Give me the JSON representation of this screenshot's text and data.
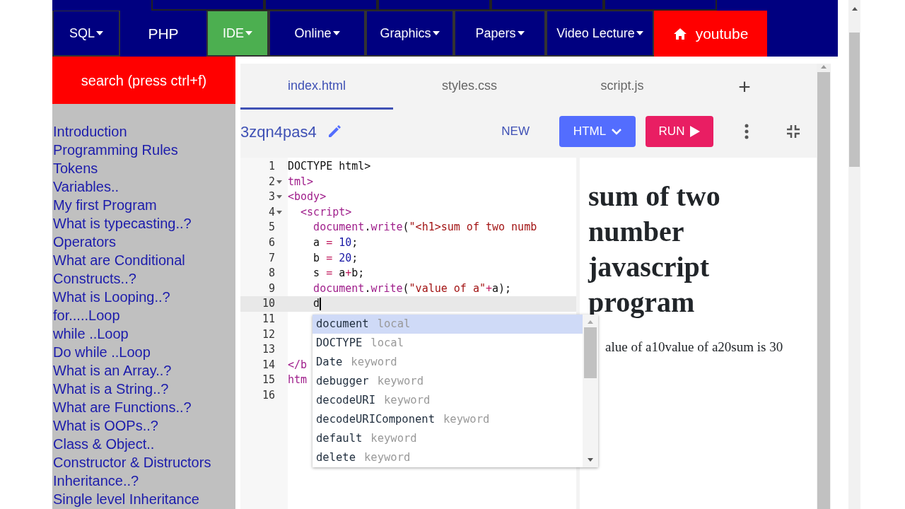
{
  "top_nav": {
    "items": [
      {
        "label": "SQL",
        "kind": "dropdown",
        "color": "#000080"
      },
      {
        "label": "PHP",
        "kind": "plain",
        "color": "#000080"
      },
      {
        "label": "IDE",
        "kind": "dropdown",
        "color": "#4caf50"
      },
      {
        "label": "Online",
        "kind": "dropdown",
        "color": "#000080"
      },
      {
        "label": "Graphics",
        "kind": "dropdown",
        "color": "#000080"
      },
      {
        "label": "Papers",
        "kind": "dropdown",
        "color": "#000080"
      },
      {
        "label": "Video Lecture",
        "kind": "dropdown",
        "color": "#000080"
      },
      {
        "label": "youtube",
        "kind": "home",
        "color": "#ff0000"
      }
    ]
  },
  "sidebar": {
    "search_button": "search (press ctrl+f)",
    "links": [
      "Introduction",
      "Programming Rules",
      "Tokens",
      "Variables..",
      "My first Program",
      "What is typecasting..?",
      "Operators",
      "What are Conditional Constructs..?",
      "What is Looping..?",
      "for.....Loop",
      "while ..Loop",
      "Do while ..Loop",
      "What is an Array..?",
      "What is a String..?",
      "What are Functions..?",
      "What is OOPs..?",
      "Class & Object..",
      "Constructor & Distructors",
      "Inheritance..?",
      "Single level Inheritance"
    ]
  },
  "ide": {
    "tabs": [
      {
        "label": "index.html",
        "selected": true
      },
      {
        "label": "styles.css",
        "selected": false
      },
      {
        "label": "script.js",
        "selected": false
      }
    ],
    "add_tab": "+",
    "project_name": "3zqn4pas4",
    "new_button": "NEW",
    "language_button": "HTML",
    "run_button": "RUN",
    "code_lines": [
      {
        "number": "1",
        "fold": false,
        "active": false,
        "segments": [
          {
            "kind": "plain",
            "text": "DOCTYPE html>"
          }
        ]
      },
      {
        "number": "2",
        "fold": true,
        "active": false,
        "segments": [
          {
            "kind": "tag",
            "text": "tml>"
          }
        ]
      },
      {
        "number": "3",
        "fold": true,
        "active": false,
        "segments": [
          {
            "kind": "tag",
            "text": "<body>"
          }
        ]
      },
      {
        "number": "4",
        "fold": true,
        "active": false,
        "segments": [
          {
            "kind": "tag",
            "text": "  <script>"
          }
        ]
      },
      {
        "number": "5",
        "fold": false,
        "active": false,
        "segments": [
          {
            "kind": "variable",
            "text": "    document"
          },
          {
            "kind": "plain",
            "text": "."
          },
          {
            "kind": "variable",
            "text": "write"
          },
          {
            "kind": "plain",
            "text": "("
          },
          {
            "kind": "string",
            "text": "\"<h1>sum of two numb"
          }
        ]
      },
      {
        "number": "6",
        "fold": false,
        "active": false,
        "segments": [
          {
            "kind": "plain",
            "text": "    a "
          },
          {
            "kind": "operator",
            "text": "="
          },
          {
            "kind": "number",
            "text": " 10"
          },
          {
            "kind": "plain",
            "text": ";"
          }
        ]
      },
      {
        "number": "7",
        "fold": false,
        "active": false,
        "segments": [
          {
            "kind": "plain",
            "text": "    b "
          },
          {
            "kind": "operator",
            "text": "="
          },
          {
            "kind": "number",
            "text": " 20"
          },
          {
            "kind": "plain",
            "text": ";"
          }
        ]
      },
      {
        "number": "8",
        "fold": false,
        "active": false,
        "segments": [
          {
            "kind": "plain",
            "text": "    s "
          },
          {
            "kind": "operator",
            "text": "="
          },
          {
            "kind": "plain",
            "text": " a"
          },
          {
            "kind": "operator",
            "text": "+"
          },
          {
            "kind": "plain",
            "text": "b;"
          }
        ]
      },
      {
        "number": "9",
        "fold": false,
        "active": false,
        "segments": [
          {
            "kind": "variable",
            "text": "    document"
          },
          {
            "kind": "plain",
            "text": "."
          },
          {
            "kind": "variable",
            "text": "write"
          },
          {
            "kind": "plain",
            "text": "("
          },
          {
            "kind": "string",
            "text": "\"value of a\""
          },
          {
            "kind": "operator",
            "text": "+"
          },
          {
            "kind": "plain",
            "text": "a);"
          }
        ]
      },
      {
        "number": "10",
        "fold": false,
        "active": true,
        "segments": [
          {
            "kind": "plain",
            "text": "    d"
          }
        ]
      },
      {
        "number": "11",
        "fold": false,
        "active": false
      },
      {
        "number": "12",
        "fold": false,
        "active": false
      },
      {
        "number": "13",
        "fold": false,
        "active": false
      },
      {
        "number": "14",
        "fold": false,
        "active": false,
        "segments": [
          {
            "kind": "tag",
            "text": "</b"
          }
        ]
      },
      {
        "number": "15",
        "fold": false,
        "active": false,
        "segments": [
          {
            "kind": "tag",
            "text": "htm"
          }
        ]
      },
      {
        "number": "16",
        "fold": false,
        "active": false
      }
    ],
    "autocomplete": [
      {
        "name": "document",
        "type": "local",
        "selected": true
      },
      {
        "name": "DOCTYPE",
        "type": "local",
        "selected": false
      },
      {
        "name": "Date",
        "type": "keyword",
        "selected": false
      },
      {
        "name": "debugger",
        "type": "keyword",
        "selected": false
      },
      {
        "name": "decodeURI",
        "type": "keyword",
        "selected": false
      },
      {
        "name": "decodeURIComponent",
        "type": "keyword",
        "selected": false
      },
      {
        "name": "default",
        "type": "keyword",
        "selected": false
      },
      {
        "name": "delete",
        "type": "keyword",
        "selected": false
      }
    ],
    "preview": {
      "heading": "sum of two number javascript program",
      "text": "alue of a10value of a20sum is 30"
    }
  }
}
